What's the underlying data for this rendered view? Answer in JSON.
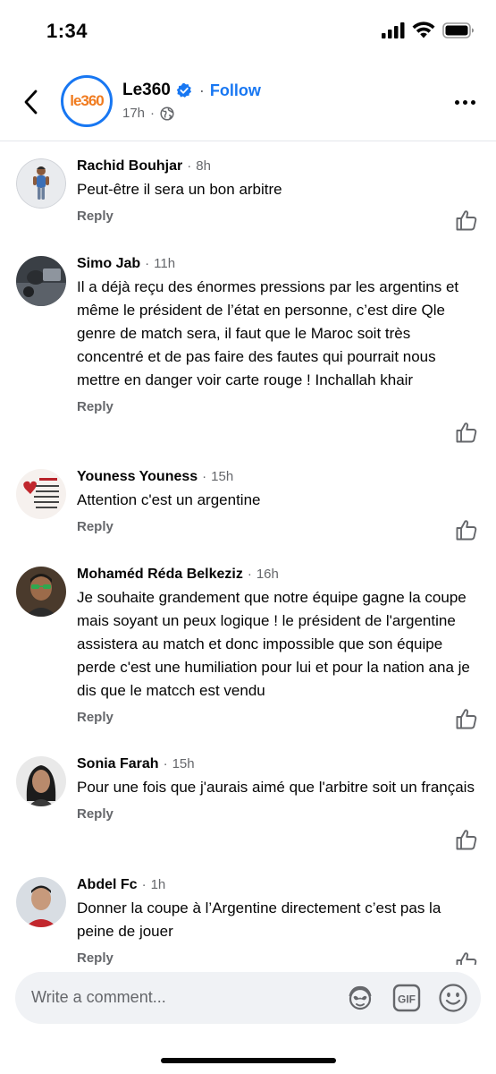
{
  "status_bar": {
    "time": "1:34"
  },
  "header": {
    "page_name": "Le360",
    "avatar_text": "le360",
    "follow": "Follow",
    "time": "17h",
    "separator": "·"
  },
  "comments": [
    {
      "name": "Rachid Bouhjar",
      "time": "8h",
      "text": "Peut-être il sera un bon arbitre",
      "reply": "Reply"
    },
    {
      "name": "Simo Jab",
      "time": "11h",
      "text": "Il a déjà reçu des énormes pressions par les argentins et même le président de l’état en personne, c’est dire Qle genre de match sera, il faut que le Maroc soit très concentré et de pas faire des fautes qui pourrait nous mettre en danger voir carte rouge ! Inchallah khair",
      "reply": "Reply"
    },
    {
      "name": "Youness Youness",
      "time": "15h",
      "text": "Attention c'est un argentine",
      "reply": "Reply"
    },
    {
      "name": "Mohaméd Réda Belkeziz",
      "time": "16h",
      "text": "Je souhaite grandement que notre équipe gagne la coupe mais soyant un peux logique ! le président de l'argentine assistera au match et donc impossible que son équipe perde c'est une humiliation pour lui et pour la nation ana je dis que le matcch est vendu",
      "reply": "Reply"
    },
    {
      "name": "Sonia Farah",
      "time": "15h",
      "text": "Pour une fois que j'aurais aimé que l'arbitre soit un français",
      "reply": "Reply"
    },
    {
      "name": "Abdel Fc",
      "time": "1h",
      "text": "Donner la coupe à l’Argentine directement c’est pas la peine de jouer",
      "reply": "Reply"
    }
  ],
  "composer": {
    "placeholder": "Write a comment...",
    "gif": "GIF"
  },
  "colors": {
    "accent": "#1877f2",
    "muted": "#65676b",
    "composer_bg": "#f0f2f5"
  }
}
